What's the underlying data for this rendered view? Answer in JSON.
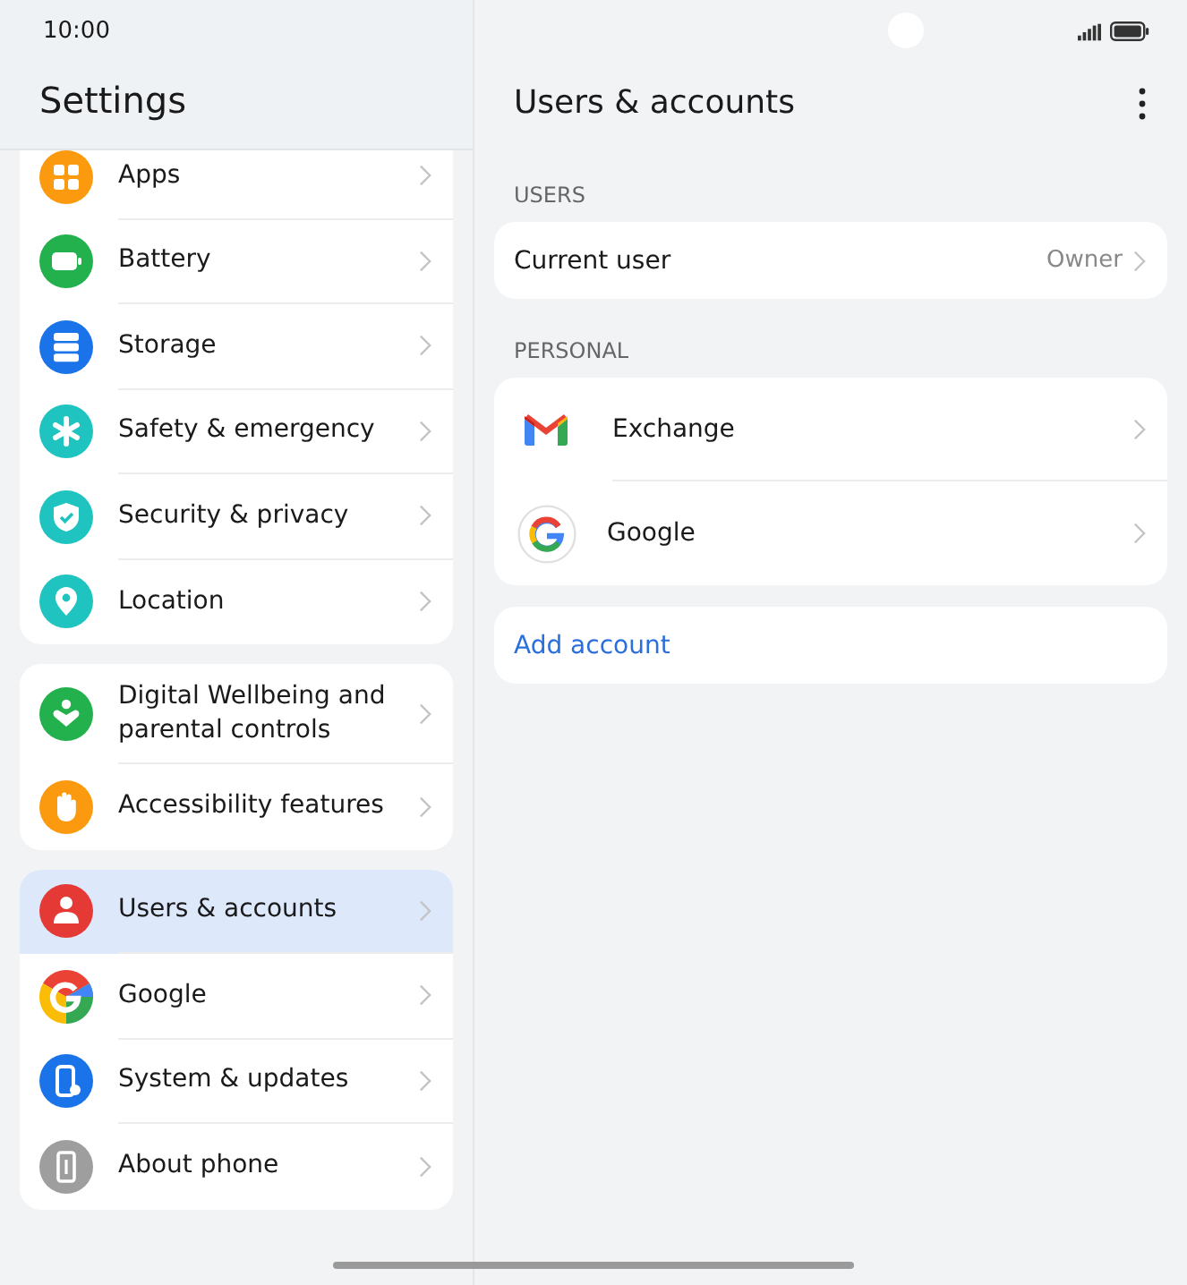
{
  "status_bar": {
    "time": "10:00"
  },
  "sidebar": {
    "title": "Settings",
    "groups": [
      {
        "items": [
          {
            "label": "Apps",
            "kind": "apps",
            "color": "#fb9a0e",
            "selected": false
          },
          {
            "label": "Battery",
            "kind": "battery",
            "color": "#22b14c",
            "selected": false
          },
          {
            "label": "Storage",
            "kind": "storage",
            "color": "#1a73e8",
            "selected": false
          },
          {
            "label": "Safety & emergency",
            "kind": "asterisk",
            "color": "#1fc3c0",
            "selected": false
          },
          {
            "label": "Security & privacy",
            "kind": "shield",
            "color": "#1fc3c0",
            "selected": false
          },
          {
            "label": "Location",
            "kind": "pin",
            "color": "#1fc3c0",
            "selected": false
          }
        ]
      },
      {
        "items": [
          {
            "label": "Digital Wellbeing and parental controls",
            "kind": "heart",
            "color": "#22b14c",
            "selected": false
          },
          {
            "label": "Accessibility features",
            "kind": "hand",
            "color": "#fb9a0e",
            "selected": false
          }
        ]
      },
      {
        "items": [
          {
            "label": "Users & accounts",
            "kind": "person",
            "color": "#e53935",
            "selected": true
          },
          {
            "label": "Google",
            "kind": "google",
            "selected": false
          },
          {
            "label": "System & updates",
            "kind": "phone",
            "color": "#1a73e8",
            "selected": false
          },
          {
            "label": "About phone",
            "kind": "info",
            "color": "#9e9e9e",
            "selected": false
          }
        ]
      }
    ]
  },
  "detail": {
    "title": "Users & accounts",
    "sections": [
      {
        "heading": "USERS",
        "items": [
          {
            "label": "Current user",
            "value": "Owner"
          }
        ]
      },
      {
        "heading": "PERSONAL",
        "items": [
          {
            "label": "Exchange",
            "kind": "gmail"
          },
          {
            "label": "Google",
            "kind": "google"
          }
        ]
      }
    ],
    "add_account": "Add account"
  }
}
